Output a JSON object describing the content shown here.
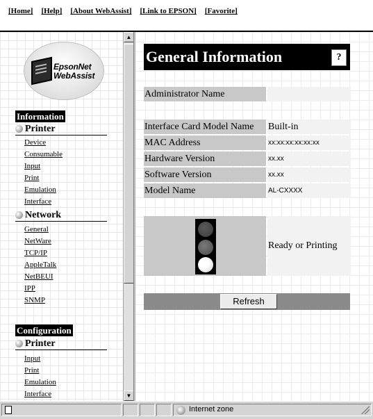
{
  "nav": {
    "items": [
      "[Home]",
      "[Help]",
      "[About WebAssist]",
      "[Link to EPSON]",
      "[Favorite]"
    ]
  },
  "logo": {
    "line1": "EpsonNet",
    "line2": "WebAssist"
  },
  "sidebar": {
    "information": {
      "title": "Information",
      "printer": {
        "title": "Printer",
        "links": [
          "Device",
          "Consumable",
          "Input",
          "Print",
          "Emulation",
          "Interface"
        ]
      },
      "network": {
        "title": "Network",
        "links": [
          "General",
          "NetWare",
          "TCP/IP",
          "AppleTalk",
          "NetBEUI",
          "IPP",
          "SNMP"
        ]
      }
    },
    "configuration": {
      "title": "Configuration",
      "printer": {
        "title": "Printer",
        "links": [
          "Input",
          "Print",
          "Emulation",
          "Interface"
        ]
      }
    }
  },
  "main": {
    "title": "General Information",
    "help_icon": "?",
    "rows": [
      {
        "label": "Administrator Name",
        "value": ""
      },
      {
        "label": "Interface Card Model Name",
        "value": "Built-in"
      },
      {
        "label": "MAC Address",
        "value": "xx:xx:xx:xx:xx:xx"
      },
      {
        "label": "Hardware Version",
        "value": "xx.xx"
      },
      {
        "label": "Software Version",
        "value": "xx.xx"
      },
      {
        "label": "Model Name",
        "value": "AL-CXXXX"
      }
    ],
    "status_text": "Ready or Printing",
    "refresh_label": "Refresh"
  },
  "statusbar": {
    "zone_text": "Internet zone"
  },
  "icons": {
    "traffic_light": "traffic-light-icon",
    "globe": "internet-zone-icon",
    "bullet": "sphere-bullet-icon"
  }
}
